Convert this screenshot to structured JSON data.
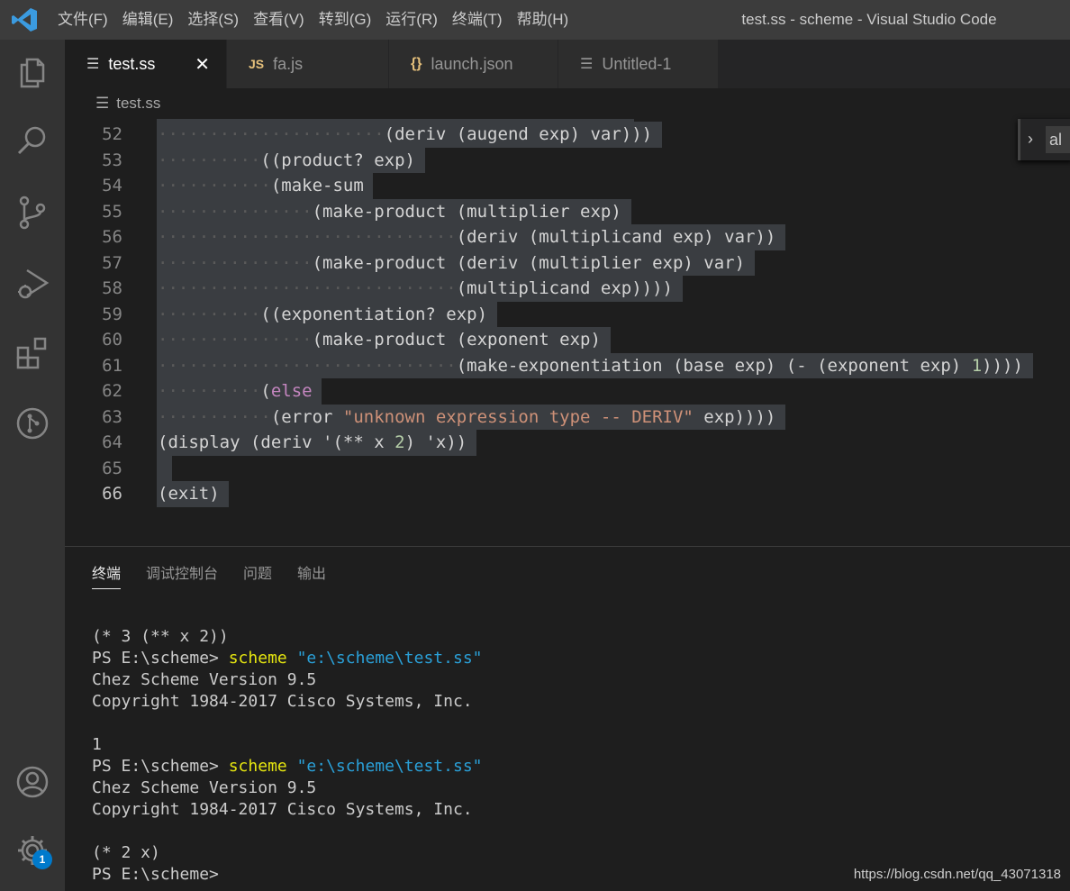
{
  "window": {
    "title": "test.ss - scheme - Visual Studio Code"
  },
  "menu": [
    "文件(F)",
    "编辑(E)",
    "选择(S)",
    "查看(V)",
    "转到(G)",
    "运行(R)",
    "终端(T)",
    "帮助(H)"
  ],
  "tabs": [
    {
      "label": "test.ss",
      "icon": "file-lines-icon",
      "active": true
    },
    {
      "label": "fa.js",
      "icon": "js-icon",
      "icon_text": "JS"
    },
    {
      "label": "launch.json",
      "icon": "json-braces-icon",
      "icon_text": "{}"
    },
    {
      "label": "Untitled-1",
      "icon": "file-lines-icon"
    }
  ],
  "breadcrumb": {
    "file": "test.ss"
  },
  "find_widget": {
    "text": "al"
  },
  "editor": {
    "lines": [
      {
        "n": "52",
        "indent": 22,
        "code": "(deriv (augend exp) var)))"
      },
      {
        "n": "53",
        "indent": 10,
        "code": "((product? exp)"
      },
      {
        "n": "54",
        "indent": 11,
        "code": "(make-sum"
      },
      {
        "n": "55",
        "indent": 15,
        "code": "(make-product (multiplier exp)"
      },
      {
        "n": "56",
        "indent": 29,
        "code": "(deriv (multiplicand exp) var))"
      },
      {
        "n": "57",
        "indent": 15,
        "code": "(make-product (deriv (multiplier exp) var)"
      },
      {
        "n": "58",
        "indent": 29,
        "code": "(multiplicand exp))))"
      },
      {
        "n": "59",
        "indent": 10,
        "code": "((exponentiation? exp)"
      },
      {
        "n": "60",
        "indent": 15,
        "code": "(make-product (exponent exp)"
      },
      {
        "n": "61",
        "indent": 29,
        "code": "(make-exponentiation (base exp) (- (exponent exp) 1))))"
      },
      {
        "n": "62",
        "indent": 10,
        "code": "(else"
      },
      {
        "n": "63",
        "indent": 11,
        "code": "(error \"unknown expression type -- DERIV\" exp))))"
      },
      {
        "n": "64",
        "indent": 0,
        "code": "(display (deriv '(** x 2) 'x))"
      },
      {
        "n": "65",
        "indent": 0,
        "code": ""
      },
      {
        "n": "66",
        "indent": 0,
        "code": "(exit)",
        "current": true
      }
    ]
  },
  "panel": {
    "tabs": [
      "终端",
      "调试控制台",
      "问题",
      "输出"
    ],
    "terminal": [
      {
        "text": "(* 3 (** x 2))"
      },
      {
        "prompt": "PS E:\\scheme> ",
        "cmd": "scheme",
        "arg": " \"e:\\scheme\\test.ss\""
      },
      {
        "text": "Chez Scheme Version 9.5"
      },
      {
        "text": "Copyright 1984-2017 Cisco Systems, Inc."
      },
      {
        "text": ""
      },
      {
        "text": "1"
      },
      {
        "prompt": "PS E:\\scheme> ",
        "cmd": "scheme",
        "arg": " \"e:\\scheme\\test.ss\""
      },
      {
        "text": "Chez Scheme Version 9.5"
      },
      {
        "text": "Copyright 1984-2017 Cisco Systems, Inc."
      },
      {
        "text": ""
      },
      {
        "text": "(* 2 x)"
      },
      {
        "text": "PS E:\\scheme> "
      }
    ]
  },
  "activity_bar": {
    "icons": [
      "explorer-icon",
      "search-icon",
      "source-control-icon",
      "run-debug-icon",
      "extensions-icon",
      "git-graph-icon",
      "account-icon",
      "settings-gear-icon"
    ],
    "settings_badge": "1"
  },
  "watermark": "https://blog.csdn.net/qq_43071318",
  "colors": {
    "accent": "#007acc",
    "keyword": "#c586c0",
    "string": "#ce9178",
    "number": "#b5cea8",
    "terminal_cmd": "#e5e510",
    "terminal_str": "#2aa0d8"
  }
}
